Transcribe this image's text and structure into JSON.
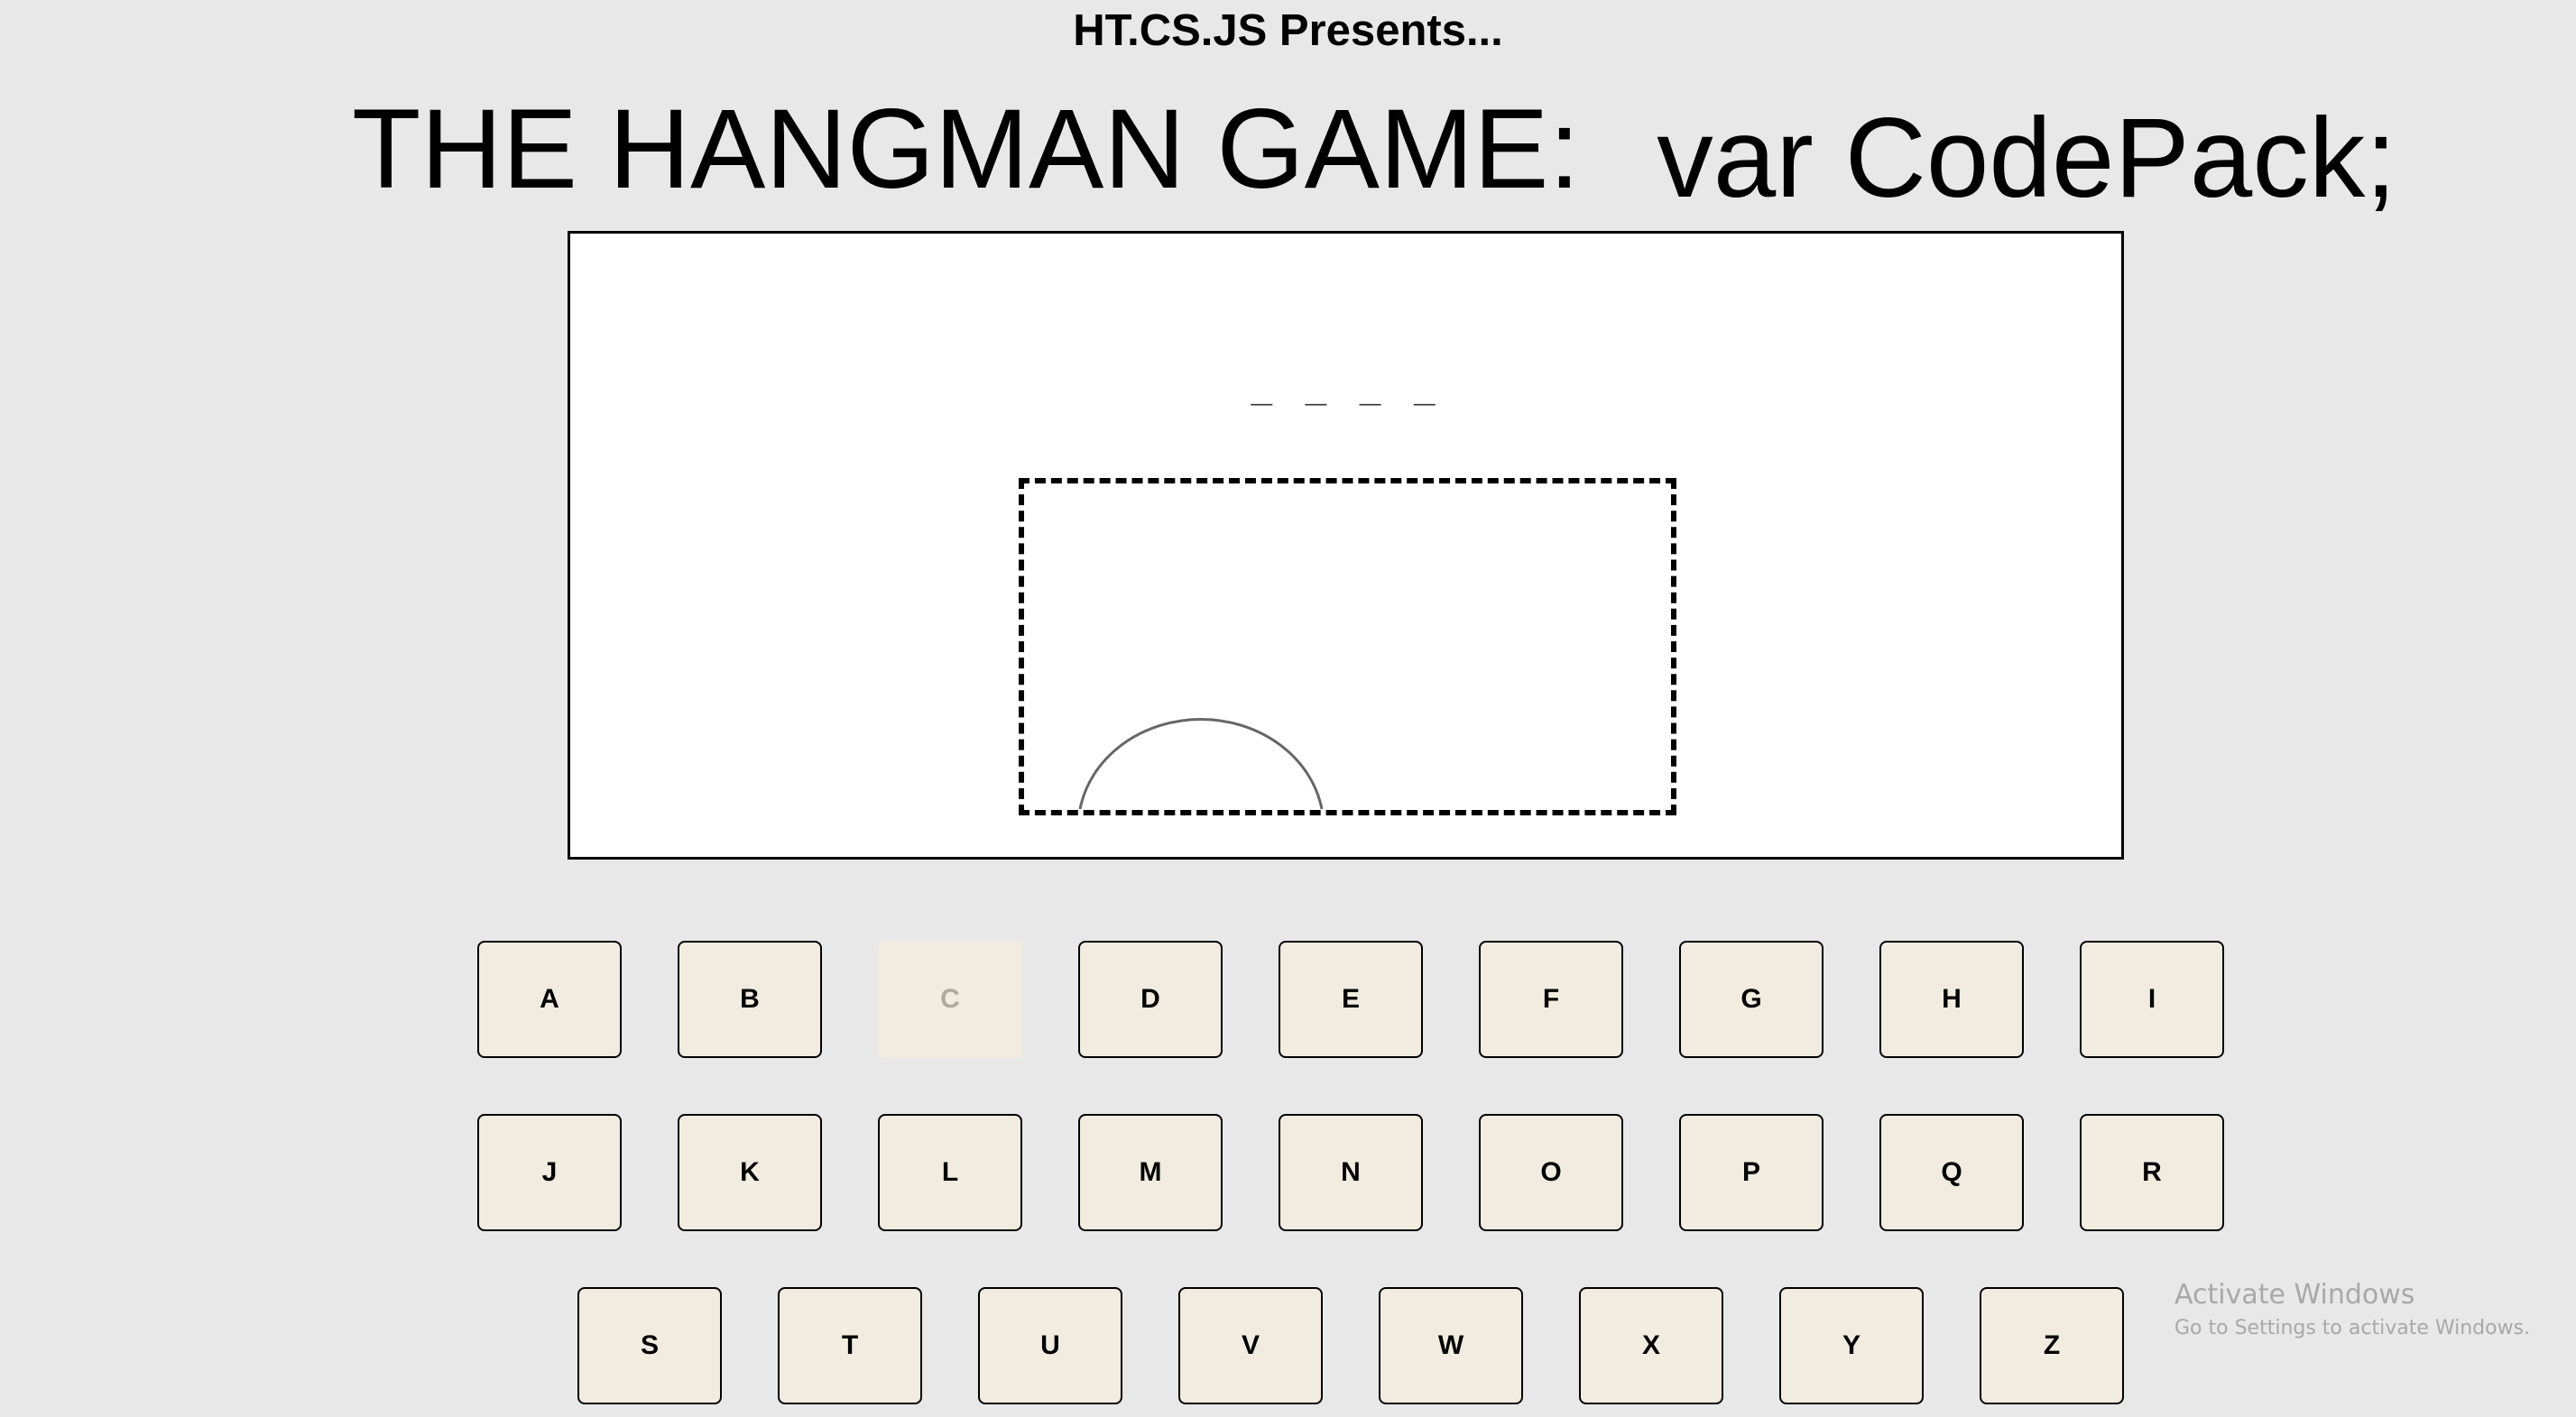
{
  "header": {
    "presents": "HT.CS.JS Presents...",
    "title": "THE HANGMAN GAME:",
    "subtitle": "var CodePack;"
  },
  "game": {
    "word_display": "_ _ _ _"
  },
  "keyboard": {
    "keys": [
      "A",
      "B",
      "C",
      "D",
      "E",
      "F",
      "G",
      "H",
      "I",
      "J",
      "K",
      "L",
      "M",
      "N",
      "O",
      "P",
      "Q",
      "R",
      "S",
      "T",
      "U",
      "V",
      "W",
      "X",
      "Y",
      "Z"
    ],
    "disabled_keys": [
      "C"
    ]
  },
  "watermark": {
    "title": "Activate Windows",
    "subtitle": "Go to Settings to activate Windows."
  },
  "colors": {
    "background": "#e8e8e8",
    "key_background": "#f1ebe0",
    "board": "#ffffff"
  }
}
